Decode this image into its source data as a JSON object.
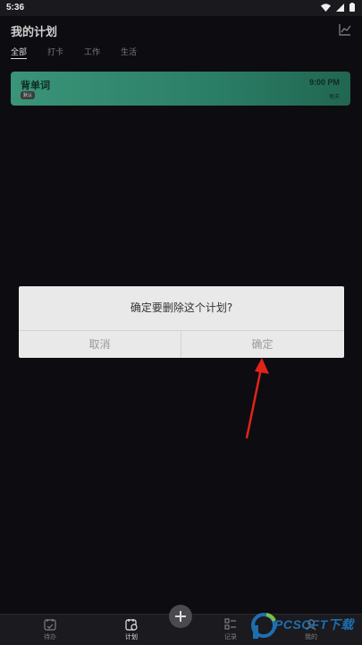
{
  "status_bar": {
    "time": "5:36"
  },
  "header": {
    "title": "我的计划"
  },
  "tabs": [
    {
      "label": "全部",
      "active": true
    },
    {
      "label": "打卡",
      "active": false
    },
    {
      "label": "工作",
      "active": false
    },
    {
      "label": "生活",
      "active": false
    }
  ],
  "plan_card": {
    "name": "背单词",
    "badge": "默认",
    "time": "9:00 PM",
    "repeat": "每天",
    "color": "#2f8a6e"
  },
  "dialog": {
    "message": "确定要删除这个计划?",
    "cancel_label": "取消",
    "confirm_label": "确定"
  },
  "bottom_nav": [
    {
      "label": "待办",
      "icon": "calendar-icon",
      "active": false
    },
    {
      "label": "计划",
      "icon": "plan-calendar-icon",
      "active": true
    },
    {
      "label": "记录",
      "icon": "list-icon",
      "active": false
    },
    {
      "label": "我的",
      "icon": "profile-icon",
      "active": false
    }
  ],
  "fab": {
    "icon": "plus-icon"
  },
  "watermark": {
    "text": "PCSOFT下载"
  },
  "colors": {
    "background": "#0d0c10",
    "accent": "#2f8a6e",
    "arrow": "#e0241b"
  }
}
